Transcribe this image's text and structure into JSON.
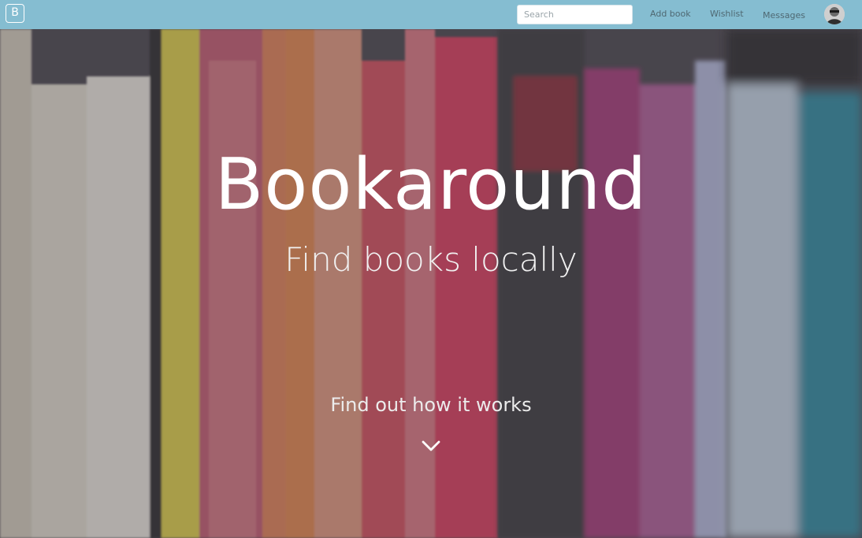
{
  "navbar": {
    "logo_letter": "B",
    "search_placeholder": "Search",
    "links": {
      "add_book": "Add book",
      "wishlist": "Wishlist",
      "messages": "Messages"
    },
    "background_color": "#85bdd1"
  },
  "hero": {
    "title": "Bookaround",
    "subtitle": "Find books locally",
    "cta": "Find out how it works",
    "cta_icon": "chevron-down-icon"
  },
  "user": {
    "avatar_icon": "user-avatar"
  }
}
